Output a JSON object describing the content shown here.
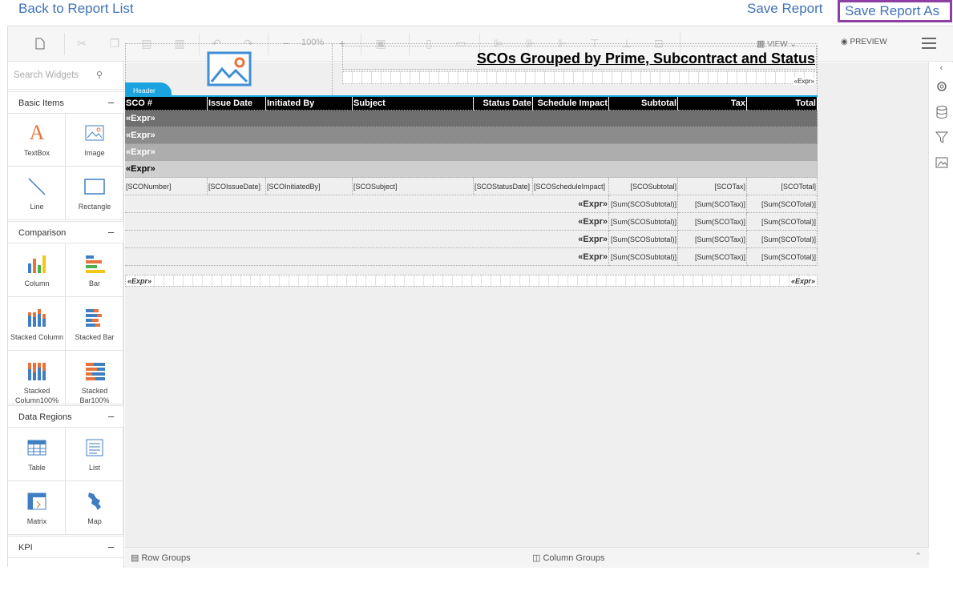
{
  "topbar": {
    "back": "Back to Report List",
    "save": "Save Report",
    "save_as": "Save Report As"
  },
  "toolbar": {
    "zoom": "100%",
    "view": "VIEW",
    "preview": "PREVIEW"
  },
  "left": {
    "search_placeholder": "Search Widgets",
    "sections": {
      "basic": "Basic Items",
      "comparison": "Comparison",
      "regions": "Data Regions",
      "kpi": "KPI"
    },
    "widgets": {
      "textbox": "TextBox",
      "image": "Image",
      "line": "Line",
      "rectangle": "Rectangle",
      "column": "Column",
      "bar": "Bar",
      "stacked_column": "Stacked Column",
      "stacked_bar": "Stacked Bar",
      "stacked_column100": "Stacked Column100%",
      "stacked_bar100": "Stacked Bar100%",
      "table": "Table",
      "list": "List",
      "matrix": "Matrix",
      "map": "Map"
    }
  },
  "groups": {
    "row": "Row Groups",
    "column": "Column Groups"
  },
  "report": {
    "title": "SCOs Grouped by Prime, Subcontract and Status",
    "header_expr": "«Expr»",
    "header_tab": "Header",
    "columns": [
      "SCO #",
      "Issue Date",
      "Initiated By",
      "Subject",
      "Status Date",
      "Schedule Impact",
      "Subtotal",
      "Tax",
      "Total"
    ],
    "group_rows": [
      "«Expr»",
      "«Expr»",
      "«Expr»",
      "«Expr»"
    ],
    "detail": [
      "[SCONumber]",
      "[SCOIssueDate]",
      "[SCOInitiatedBy]",
      "[SCOSubject]",
      "[SCOStatusDate]",
      "[SCOScheduleImpact]",
      "[SCOSubtotal]",
      "[SCOTax]",
      "[SCOTotal]"
    ],
    "total_rows": [
      {
        "expr": "«Expr»",
        "subtotal": "[Sum(SCOSubtotal)]",
        "tax": "[Sum(SCOTax)]",
        "total": "[Sum(SCOTotal)]"
      },
      {
        "expr": "«Expr»",
        "subtotal": "[Sum(SCOSubtotal)]",
        "tax": "[Sum(SCOTax)]",
        "total": "[Sum(SCOTotal)]"
      },
      {
        "expr": "«Expr»",
        "subtotal": "[Sum(SCOSubtotal)]",
        "tax": "[Sum(SCOTax)]",
        "total": "[Sum(SCOTotal)]"
      },
      {
        "expr": "«Expr»",
        "subtotal": "[Sum(SCOSubtotal)]",
        "tax": "[Sum(SCOTax)]",
        "total": "[Sum(SCOTotal)]"
      }
    ],
    "footer_left": "«Expr»",
    "footer_right": "«Expr»",
    "group_colors": [
      "#6f6f6f",
      "#8c8c8c",
      "#adadad",
      "#cfcfcf"
    ]
  }
}
